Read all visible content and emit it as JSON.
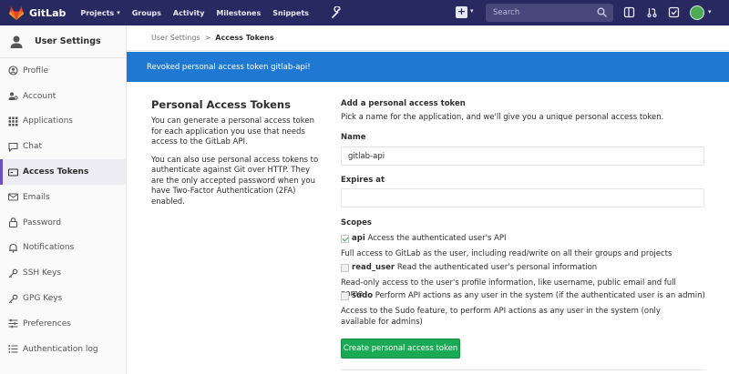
{
  "topbar": {
    "brand": "GitLab",
    "nav": [
      {
        "label": "Projects",
        "has_dropdown": true
      },
      {
        "label": "Groups",
        "has_dropdown": false
      },
      {
        "label": "Activity",
        "has_dropdown": false
      },
      {
        "label": "Milestones",
        "has_dropdown": false
      },
      {
        "label": "Snippets",
        "has_dropdown": false
      }
    ],
    "search_placeholder": "Search",
    "colors": {
      "bar": "#292961",
      "search": "#47477c"
    },
    "icons": [
      "wrench-icon",
      "plus-icon",
      "search-icon",
      "panel-icon",
      "merge-request-icon",
      "todo-check-icon",
      "avatar"
    ]
  },
  "sidebar": {
    "title": "User Settings",
    "items": [
      {
        "label": "Profile",
        "icon": "profile-icon"
      },
      {
        "label": "Account",
        "icon": "account-icon"
      },
      {
        "label": "Applications",
        "icon": "applications-icon"
      },
      {
        "label": "Chat",
        "icon": "chat-icon"
      },
      {
        "label": "Access Tokens",
        "icon": "access-tokens-icon",
        "active": true
      },
      {
        "label": "Emails",
        "icon": "emails-icon"
      },
      {
        "label": "Password",
        "icon": "password-icon"
      },
      {
        "label": "Notifications",
        "icon": "notifications-icon"
      },
      {
        "label": "SSH Keys",
        "icon": "ssh-keys-icon"
      },
      {
        "label": "GPG Keys",
        "icon": "gpg-keys-icon"
      },
      {
        "label": "Preferences",
        "icon": "preferences-icon"
      },
      {
        "label": "Authentication log",
        "icon": "authentication-log-icon"
      }
    ]
  },
  "breadcrumb": {
    "parent": "User Settings",
    "sep": ">",
    "current": "Access Tokens"
  },
  "flash": {
    "message": "Revoked personal access token gitlab-api!",
    "color": "#1f78d1"
  },
  "intro": {
    "title": "Personal Access Tokens",
    "p1": "You can generate a personal access token for each application you use that needs access to the GitLab API.",
    "p2": "You can also use personal access tokens to authenticate against Git over HTTP. They are the only accepted password when you have Two-Factor Authentication (2FA) enabled."
  },
  "form": {
    "heading": "Add a personal access token",
    "subheading": "Pick a name for the application, and we'll give you a unique personal access token.",
    "name_label": "Name",
    "name_value": "gitlab-api",
    "expires_label": "Expires at",
    "expires_value": "",
    "scopes_label": "Scopes",
    "scopes": [
      {
        "name": "api",
        "label": "Access the authenticated user's API",
        "checked": true,
        "description": "Full access to GitLab as the user, including read/write on all their groups and projects"
      },
      {
        "name": "read_user",
        "label": "Read the authenticated user's personal information",
        "checked": false,
        "description": "Read-only access to the user's profile information, like username, public email and full name"
      },
      {
        "name": "sudo",
        "label": "Perform API actions as any user in the system (if the authenticated user is an admin)",
        "checked": false,
        "description": "Access to the Sudo feature, to perform API actions as any user in the system (only available for admins)"
      }
    ],
    "submit_label": "Create personal access token",
    "submit_color": "#1aaa55"
  }
}
